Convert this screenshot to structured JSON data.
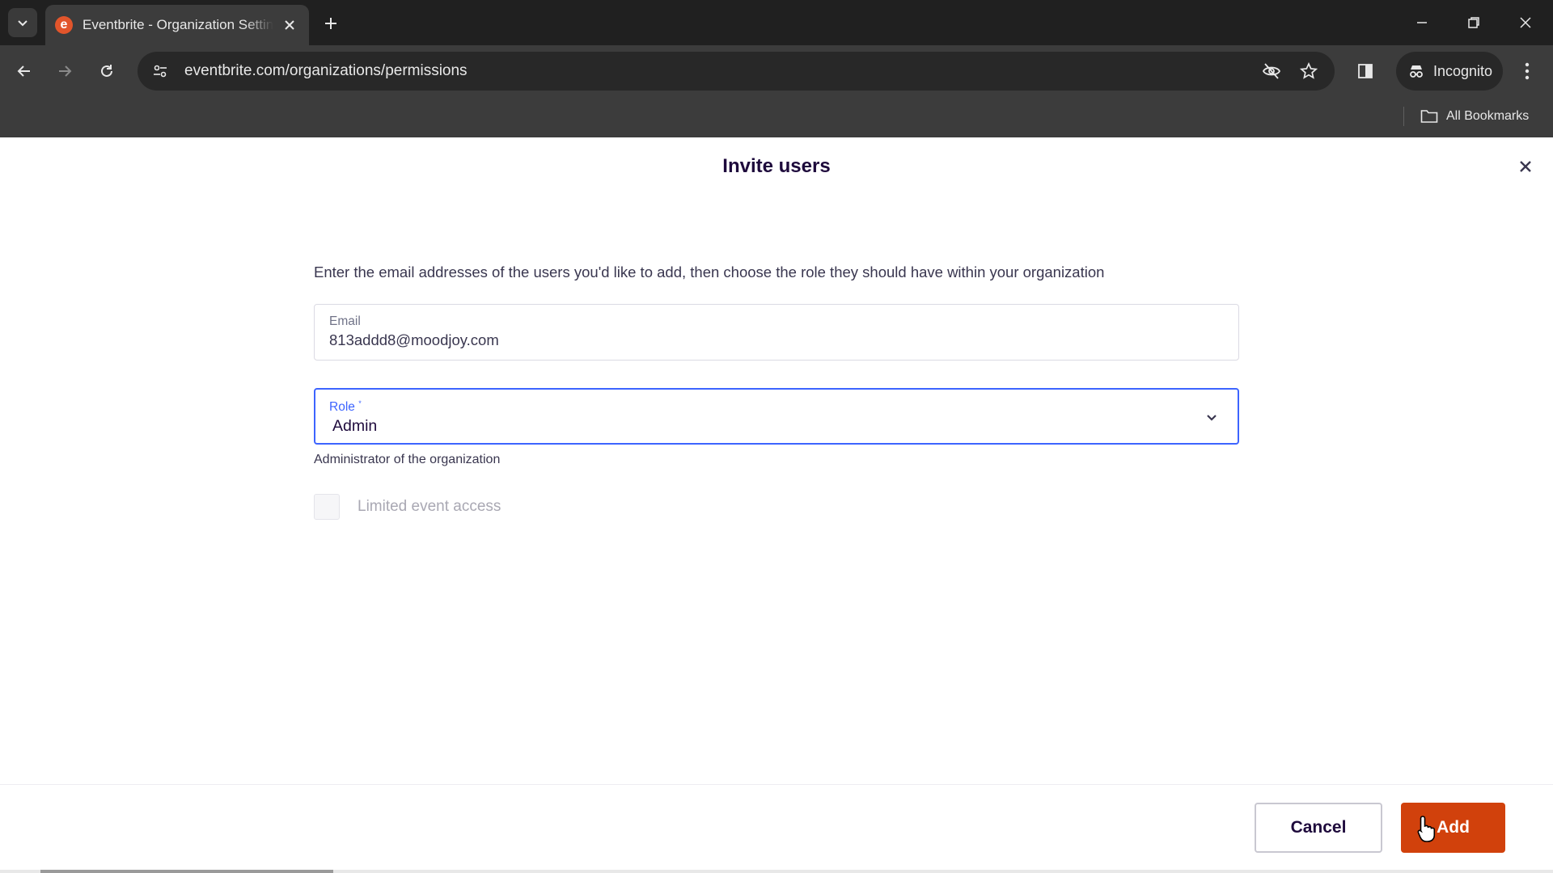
{
  "browser": {
    "tab": {
      "title": "Eventbrite - Organization Settings",
      "favicon_letter": "e"
    },
    "url": "eventbrite.com/organizations/permissions",
    "incognito_label": "Incognito",
    "bookmarks_label": "All Bookmarks"
  },
  "modal": {
    "title": "Invite users",
    "instructions": "Enter the email addresses of the users you'd like to add, then choose the role they should have within your organization",
    "email": {
      "label": "Email",
      "value": "813addd8@moodjoy.com"
    },
    "role": {
      "label": "Role",
      "required_mark": "*",
      "value": "Admin",
      "helper": "Administrator of the organization"
    },
    "limited_access": {
      "label": "Limited event access",
      "checked": false,
      "disabled": true
    },
    "cancel_label": "Cancel",
    "add_label": "Add"
  },
  "colors": {
    "brand_orange": "#d1410c",
    "focus_blue": "#3d64ff",
    "title_text": "#1e0a3c"
  }
}
